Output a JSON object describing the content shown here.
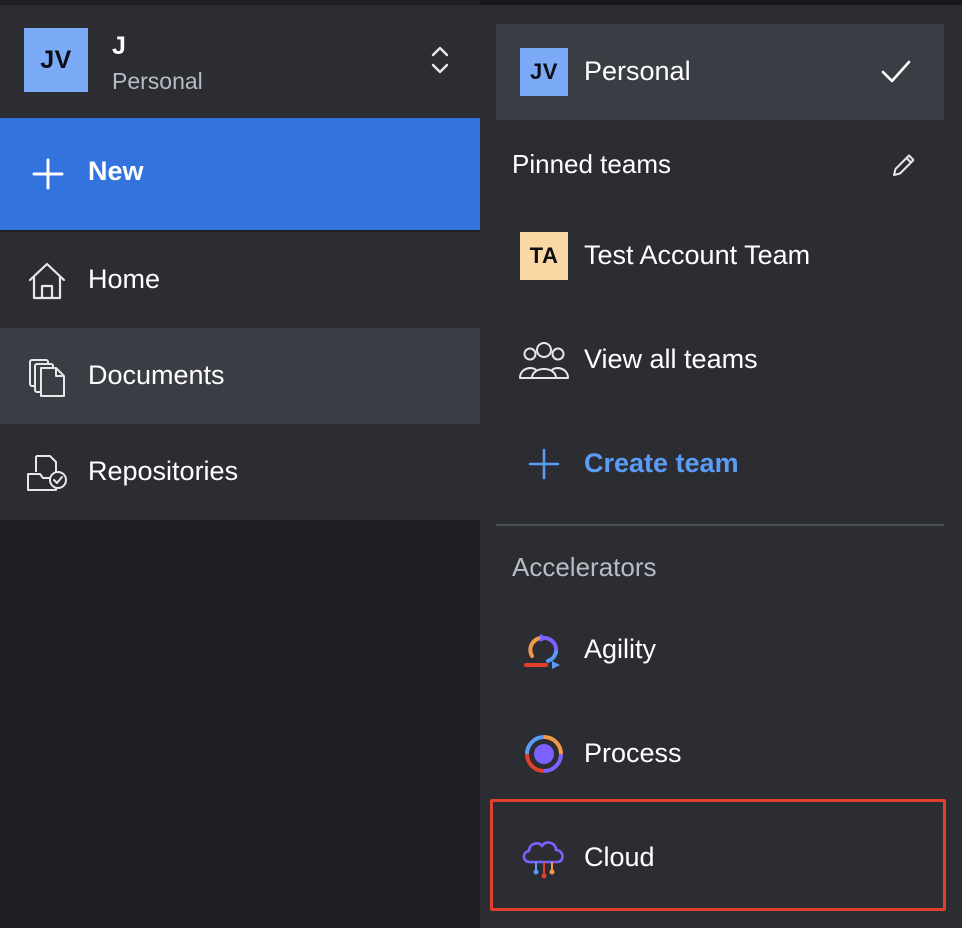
{
  "account": {
    "avatar_initials": "JV",
    "name": "J",
    "workspace": "Personal"
  },
  "sidebar": {
    "new_label": "New",
    "items": [
      {
        "label": "Home",
        "icon": "home-icon",
        "active": false
      },
      {
        "label": "Documents",
        "icon": "documents-icon",
        "active": true
      },
      {
        "label": "Repositories",
        "icon": "repositories-icon",
        "active": false
      }
    ]
  },
  "panel": {
    "current": {
      "avatar_initials": "JV",
      "label": "Personal"
    },
    "pinned_title": "Pinned teams",
    "teams": [
      {
        "avatar_initials": "TA",
        "label": "Test Account Team"
      }
    ],
    "view_all_label": "View all teams",
    "create_team_label": "Create team",
    "accelerators_title": "Accelerators",
    "accelerators": [
      {
        "label": "Agility",
        "icon": "agility-icon"
      },
      {
        "label": "Process",
        "icon": "process-icon"
      },
      {
        "label": "Cloud",
        "icon": "cloud-icon",
        "highlighted": true
      }
    ]
  },
  "colors": {
    "accent_blue": "#3373dd",
    "link_blue": "#5b9cf6",
    "highlight_red": "#e0402d",
    "avatar_blue": "#7baaf7",
    "avatar_orange": "#fbd7a4"
  }
}
